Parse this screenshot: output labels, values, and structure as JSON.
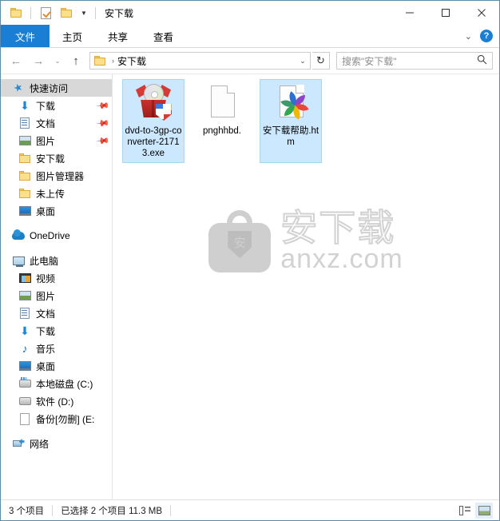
{
  "window": {
    "title": "安下载",
    "quick_access_toolbar": [
      {
        "name": "folder-properties-icon",
        "label": "属性"
      },
      {
        "name": "new-folder-icon",
        "label": "新建文件夹"
      },
      {
        "name": "customize-caret-icon",
        "label": "自定义快速访问工具栏"
      }
    ],
    "controls": {
      "minimize": "最小化",
      "maximize": "最大化",
      "close": "关闭"
    }
  },
  "ribbon": {
    "tabs": [
      {
        "label": "文件",
        "selected": true
      },
      {
        "label": "主页",
        "selected": false
      },
      {
        "label": "共享",
        "selected": false
      },
      {
        "label": "查看",
        "selected": false
      }
    ],
    "expand_label": "展开功能区",
    "help_label": "?"
  },
  "addressbar": {
    "back": "←",
    "forward": "→",
    "recent": "⌄",
    "up": "↑",
    "crumb_separator": "›",
    "path_text": "安下载",
    "dropdown": "⌄",
    "refresh": "↻"
  },
  "search": {
    "placeholder": "搜索\"安下载\"",
    "icon": "search-icon"
  },
  "sidebar": {
    "groups": [
      {
        "items": [
          {
            "label": "快速访问",
            "icon": "star-pin-icon",
            "indent": 0,
            "selected": true,
            "pinned": false
          },
          {
            "label": "下载",
            "icon": "download-icon",
            "indent": 1,
            "selected": false,
            "pinned": true
          },
          {
            "label": "文档",
            "icon": "documents-icon",
            "indent": 1,
            "selected": false,
            "pinned": true
          },
          {
            "label": "图片",
            "icon": "pictures-icon",
            "indent": 1,
            "selected": false,
            "pinned": true
          },
          {
            "label": "安下载",
            "icon": "folder-icon",
            "indent": 1,
            "selected": false,
            "pinned": false
          },
          {
            "label": "图片管理器",
            "icon": "folder-icon",
            "indent": 1,
            "selected": false,
            "pinned": false
          },
          {
            "label": "未上传",
            "icon": "folder-icon",
            "indent": 1,
            "selected": false,
            "pinned": false
          },
          {
            "label": "桌面",
            "icon": "desktop-icon",
            "indent": 1,
            "selected": false,
            "pinned": false
          }
        ]
      },
      {
        "items": [
          {
            "label": "OneDrive",
            "icon": "onedrive-cloud-icon",
            "indent": 0,
            "selected": false,
            "pinned": false
          }
        ]
      },
      {
        "items": [
          {
            "label": "此电脑",
            "icon": "this-pc-icon",
            "indent": 0,
            "selected": false,
            "pinned": false
          },
          {
            "label": "视频",
            "icon": "videos-icon",
            "indent": 1,
            "selected": false,
            "pinned": false
          },
          {
            "label": "图片",
            "icon": "pictures-icon",
            "indent": 1,
            "selected": false,
            "pinned": false
          },
          {
            "label": "文档",
            "icon": "documents-icon",
            "indent": 1,
            "selected": false,
            "pinned": false
          },
          {
            "label": "下载",
            "icon": "download-icon",
            "indent": 1,
            "selected": false,
            "pinned": false
          },
          {
            "label": "音乐",
            "icon": "music-icon",
            "indent": 1,
            "selected": false,
            "pinned": false
          },
          {
            "label": "桌面",
            "icon": "desktop-icon",
            "indent": 1,
            "selected": false,
            "pinned": false
          },
          {
            "label": "本地磁盘 (C:)",
            "icon": "system-drive-icon",
            "indent": 1,
            "selected": false,
            "pinned": false
          },
          {
            "label": "软件 (D:)",
            "icon": "drive-icon",
            "indent": 1,
            "selected": false,
            "pinned": false
          },
          {
            "label": "备份[勿删] (E:",
            "icon": "file-icon",
            "indent": 1,
            "selected": false,
            "pinned": false
          }
        ]
      },
      {
        "items": [
          {
            "label": "网络",
            "icon": "network-icon",
            "indent": 0,
            "selected": false,
            "pinned": false
          }
        ]
      }
    ]
  },
  "files": [
    {
      "name": "dvd-to-3gp-converter-21713.exe",
      "icon": "dvd-converter-exe-icon",
      "selected": true
    },
    {
      "name": "pnghhbd.",
      "icon": "blank-page-icon",
      "selected": false
    },
    {
      "name": "安下载帮助.htm",
      "icon": "html-document-icon",
      "selected": true
    }
  ],
  "watermark": {
    "brand_cn": "安下载",
    "brand_en": "anxz.com",
    "shield_char": "安"
  },
  "statusbar": {
    "item_count": "3 个项目",
    "selection": "已选择 2 个项目  11.3 MB",
    "views": [
      {
        "name": "details-view-button",
        "active": false
      },
      {
        "name": "large-icons-view-button",
        "active": true
      }
    ]
  }
}
